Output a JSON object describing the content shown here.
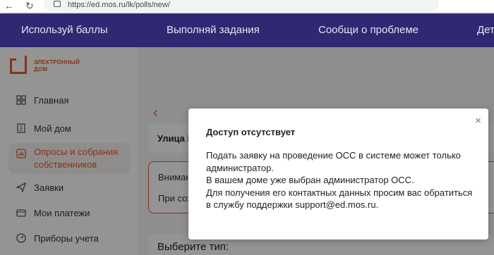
{
  "browser": {
    "url": "https://ed.mos.ru/lk/polls/new/"
  },
  "banner": {
    "tabs": [
      "Используй баллы",
      "Выполняй задания",
      "Сообщи о проблеме",
      "Дет"
    ]
  },
  "logo": {
    "text_line1": "ЭЛЕКТРОННЫЙ",
    "text_line2": "ДОМ",
    "color": "#e8592a"
  },
  "sidebar": {
    "items": [
      {
        "label": "Главная",
        "icon": "grid-icon"
      },
      {
        "label": "Мой дом",
        "icon": "building-icon"
      },
      {
        "label": "Опросы и собрания собственников",
        "icon": "bar-chart-icon",
        "active": true
      },
      {
        "label": "Заявки",
        "icon": "send-icon"
      },
      {
        "label": "Мои платежи",
        "icon": "wallet-icon"
      },
      {
        "label": "Приборы учета",
        "icon": "gauge-icon"
      }
    ]
  },
  "content": {
    "card_street": "Улица I",
    "notice_line1": "Вниман",
    "notice_line2": "При соз",
    "choose_type": "Выберите тип:"
  },
  "modal": {
    "title": "Доступ отсутствует",
    "body_lines": [
      "Подать заявку на проведение ОСС в системе может только",
      "администратор.",
      "В вашем доме уже выбран администратор ОСС.",
      "Для получения его контактных данных просим вас обратиться",
      "в службу поддержки support@ed.mos.ru."
    ],
    "close_symbol": "×"
  },
  "colors": {
    "banner": "#2f2872",
    "accent": "#e8592a"
  }
}
